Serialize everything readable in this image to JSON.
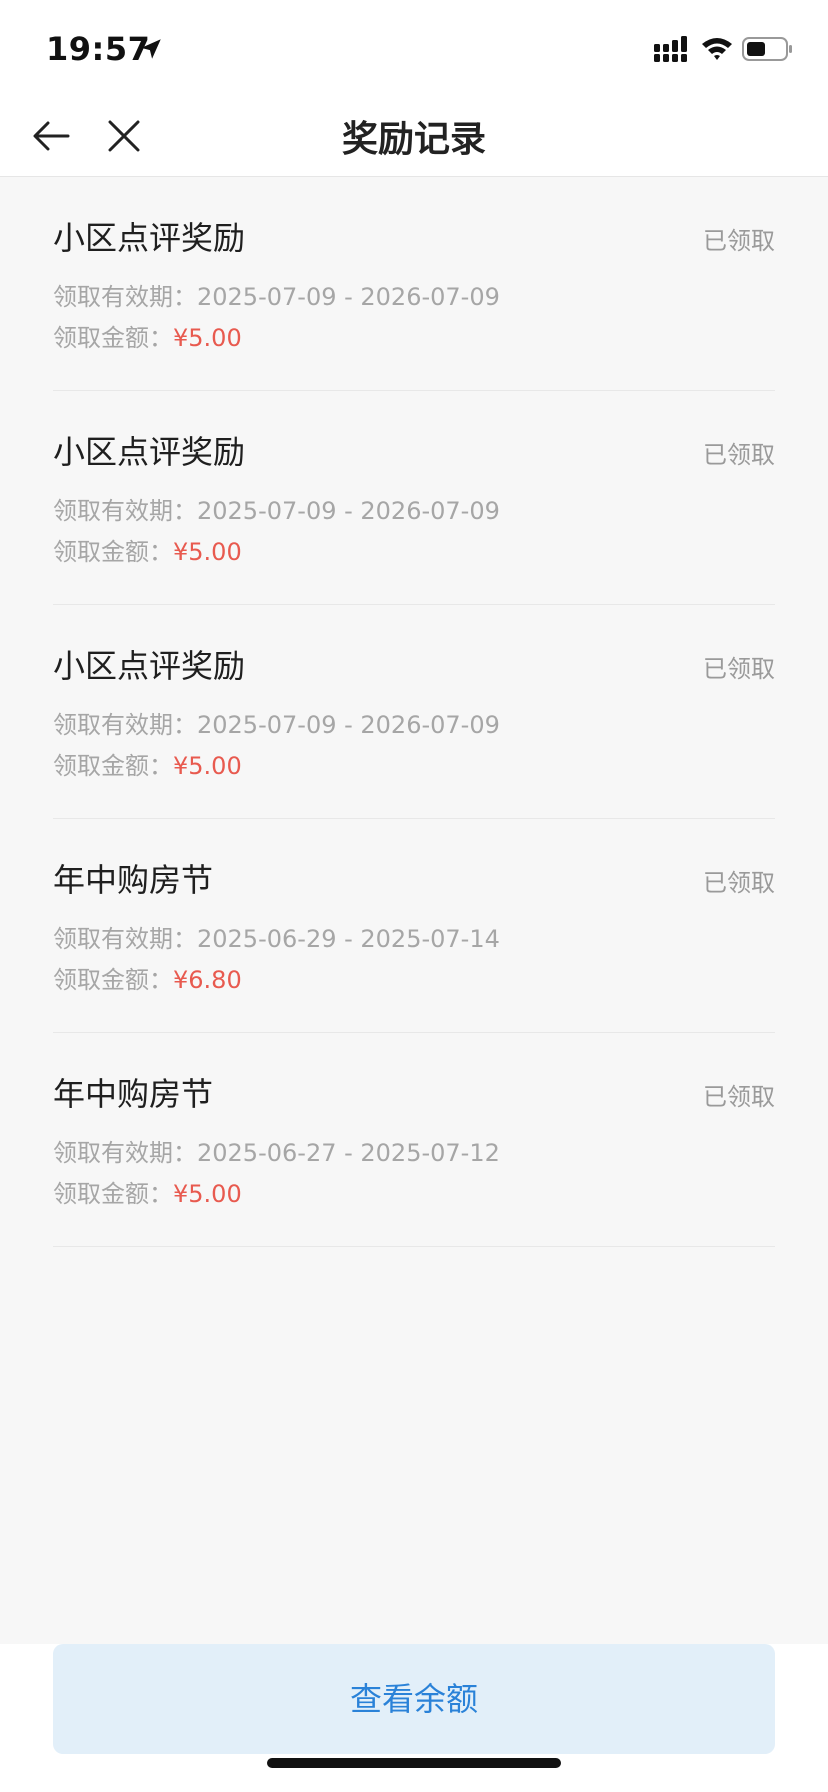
{
  "status_bar": {
    "time": "19:57"
  },
  "nav": {
    "title": "奖励记录"
  },
  "labels": {
    "period_prefix": "领取有效期：",
    "amount_prefix": "领取金额："
  },
  "rewards": [
    {
      "title": "小区点评奖励",
      "status": "已领取",
      "period": "2025-07-09 - 2026-07-09",
      "amount": "¥5.00"
    },
    {
      "title": "小区点评奖励",
      "status": "已领取",
      "period": "2025-07-09 - 2026-07-09",
      "amount": "¥5.00"
    },
    {
      "title": "小区点评奖励",
      "status": "已领取",
      "period": "2025-07-09 - 2026-07-09",
      "amount": "¥5.00"
    },
    {
      "title": "年中购房节",
      "status": "已领取",
      "period": "2025-06-29 - 2025-07-14",
      "amount": "¥6.80"
    },
    {
      "title": "年中购房节",
      "status": "已领取",
      "period": "2025-06-27 - 2025-07-12",
      "amount": "¥5.00"
    }
  ],
  "footer": {
    "balance_button_label": "查看余额"
  },
  "colors": {
    "accent_blue": "#2a82d8",
    "amount_red": "#e85a4f",
    "button_bg": "#e2eff9"
  },
  "icons": {
    "back": "arrow-left-icon",
    "close": "close-icon",
    "location": "location-arrow-icon",
    "signal": "cellular-signal-icon",
    "wifi": "wifi-icon",
    "battery": "battery-icon"
  }
}
